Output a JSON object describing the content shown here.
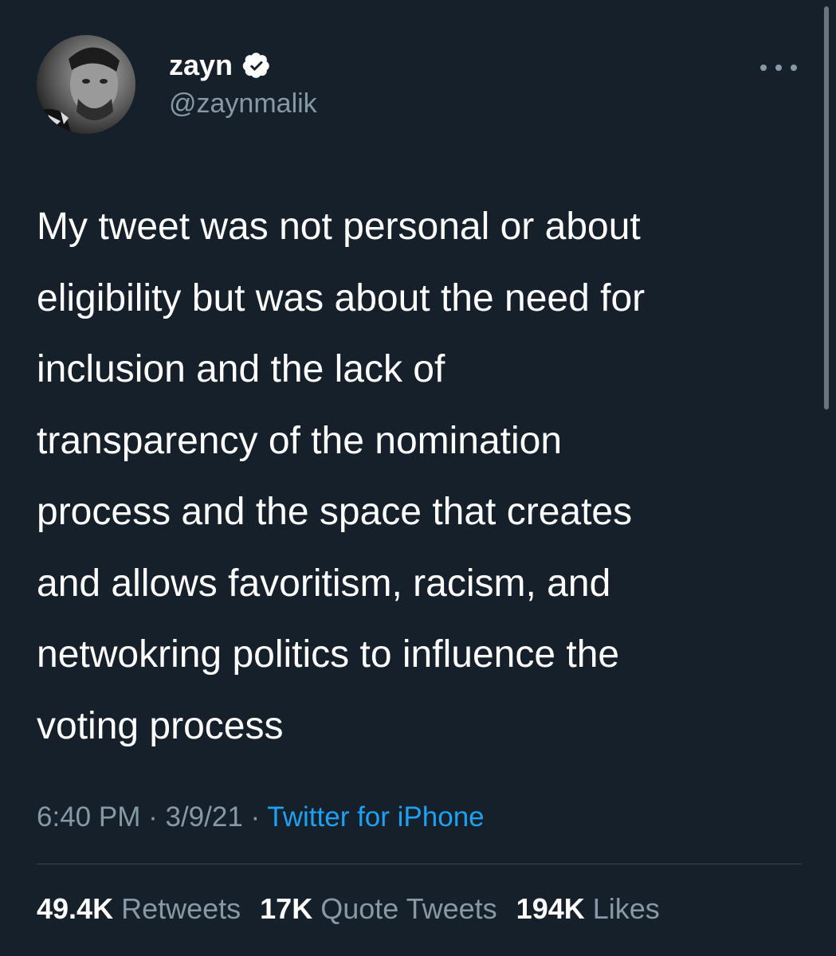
{
  "user": {
    "display_name": "zayn",
    "handle": "@zaynmalik",
    "verified": true,
    "avatar_icon": "profile-photo-icon"
  },
  "menu": {
    "icon": "more-options-icon"
  },
  "tweet": {
    "lines": [
      "My tweet was not personal or about",
      "eligibility but was about the need for",
      "inclusion and the lack of",
      "transparency of the nomination",
      "process and the space that creates",
      "and allows favoritism, racism, and",
      "netwokring politics to influence the",
      "voting process"
    ]
  },
  "meta": {
    "time": "6:40 PM",
    "separator": "·",
    "date": "3/9/21",
    "source": "Twitter for iPhone"
  },
  "stats": {
    "retweets_count": "49.4K",
    "retweets_label": "Retweets",
    "quotes_count": "17K",
    "quotes_label": "Quote Tweets",
    "likes_count": "194K",
    "likes_label": "Likes"
  },
  "colors": {
    "background": "#15202b",
    "text": "#ffffff",
    "secondary_text": "#8899a6",
    "link": "#1da1f2",
    "divider": "#38444d"
  }
}
